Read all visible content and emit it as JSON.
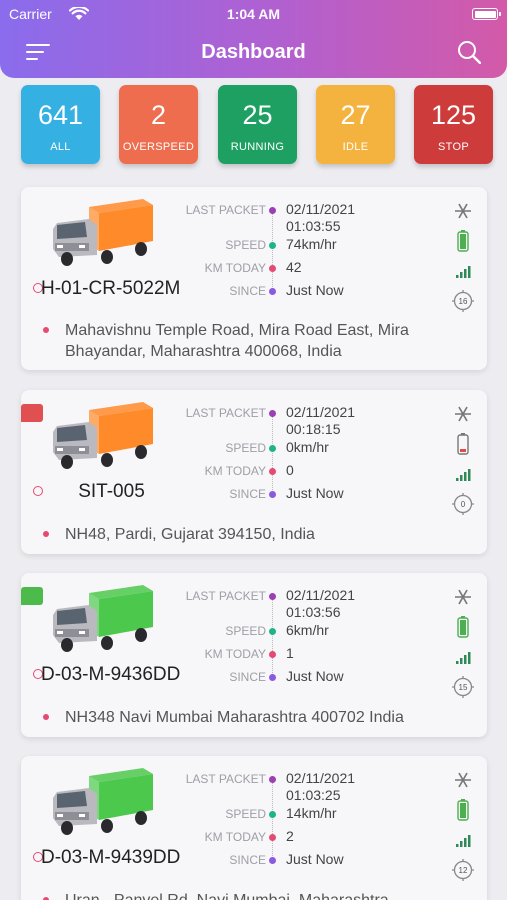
{
  "status_bar": {
    "carrier": "Carrier",
    "time": "1:04 AM"
  },
  "header": {
    "title": "Dashboard"
  },
  "tiles": [
    {
      "count": "641",
      "label": "ALL",
      "color": "#34b0e3"
    },
    {
      "count": "2",
      "label": "OVERSPEED",
      "color": "#ee6d4e"
    },
    {
      "count": "25",
      "label": "RUNNING",
      "color": "#1fa063"
    },
    {
      "count": "27",
      "label": "IDLE",
      "color": "#f4b23e"
    },
    {
      "count": "125",
      "label": "STOP",
      "color": "#cd3b3b"
    }
  ],
  "labels": {
    "last_packet": "LAST PACKET",
    "speed": "SPEED",
    "km_today": "KM TODAY",
    "since": "SINCE"
  },
  "vehicles": [
    {
      "plate": "H-01-CR-5022M",
      "truck_color": "#ff8a2a",
      "date": "02/11/2021",
      "time": "01:03:55",
      "speed": "74km/hr",
      "km_today": "42",
      "since": "Just Now",
      "address": "Mahavishnu Temple Road, Mira Road East, Mira Bhayandar, Maharashtra 400068, India",
      "battery": "full",
      "signal_count": "16"
    },
    {
      "plate": "SIT-005",
      "truck_color": "#ff8a2a",
      "date": "02/11/2021",
      "time": "00:18:15",
      "speed": "0km/hr",
      "km_today": "0",
      "since": "Just Now",
      "address": "NH48, Pardi, Gujarat 394150, India",
      "battery": "low",
      "signal_count": "0"
    },
    {
      "plate": "D-03-M-9436DD",
      "truck_color": "#4cc94c",
      "date": "02/11/2021",
      "time": "01:03:56",
      "speed": "6km/hr",
      "km_today": "1",
      "since": "Just Now",
      "address": "NH348 Navi Mumbai Maharashtra 400702 India",
      "battery": "full",
      "signal_count": "15"
    },
    {
      "plate": "D-03-M-9439DD",
      "truck_color": "#4cc94c",
      "date": "02/11/2021",
      "time": "01:03:25",
      "speed": "14km/hr",
      "km_today": "2",
      "since": "Just Now",
      "address": "Uran - Panvel Rd, Navi Mumbai, Maharashtra",
      "battery": "full",
      "signal_count": "12"
    }
  ],
  "dot_colors": {
    "last_packet": "#9b3fb5",
    "speed": "#1fb38a",
    "km_today": "#e54a72",
    "since": "#8b5ae0"
  }
}
